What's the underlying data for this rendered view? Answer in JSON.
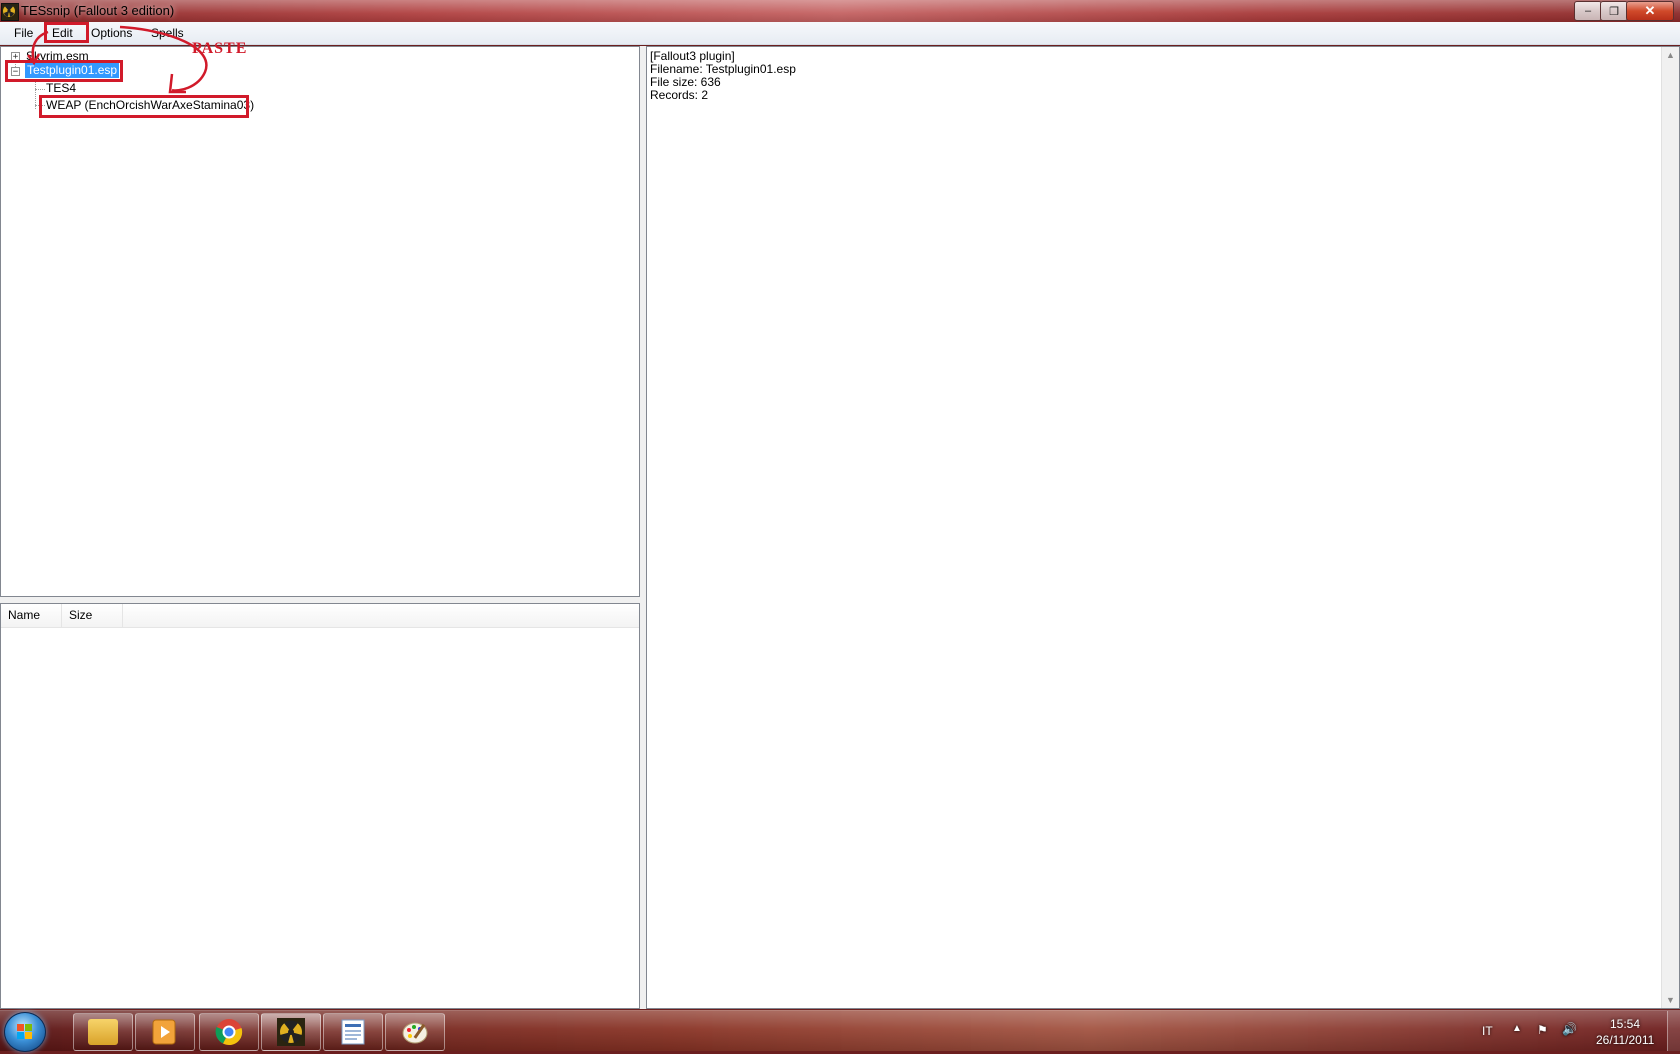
{
  "window": {
    "title": "TESsnip (Fallout 3 edition)",
    "minimize_glyph": "–",
    "maximize_glyph": "❐",
    "close_glyph": "✕"
  },
  "menu": {
    "file": "File",
    "edit": "Edit",
    "options": "Options",
    "spells": "Spells"
  },
  "tree": {
    "nodes": [
      {
        "label": "Skyrim.esm",
        "expander": "+"
      },
      {
        "label": "Testplugin01.esp",
        "expander": "−"
      },
      {
        "label": "TES4"
      },
      {
        "label": "WEAP (EnchOrcishWarAxeStamina03)"
      }
    ]
  },
  "list": {
    "columns": [
      "Name",
      "Size"
    ]
  },
  "info": {
    "lines": [
      "[Fallout3 plugin]",
      "Filename: Testplugin01.esp",
      "File size: 636",
      "Records: 2"
    ]
  },
  "annotation": {
    "paste_label": "PASTE",
    "color": "#d11a2a"
  },
  "taskbar": {
    "items": [
      "explorer-icon",
      "media-player-icon",
      "chrome-icon",
      "tessnip-icon",
      "wordpad-icon",
      "paint-icon"
    ],
    "language": "IT",
    "time": "15:54",
    "date": "26/11/2011"
  },
  "colors": {
    "selection": "#3399ff"
  }
}
